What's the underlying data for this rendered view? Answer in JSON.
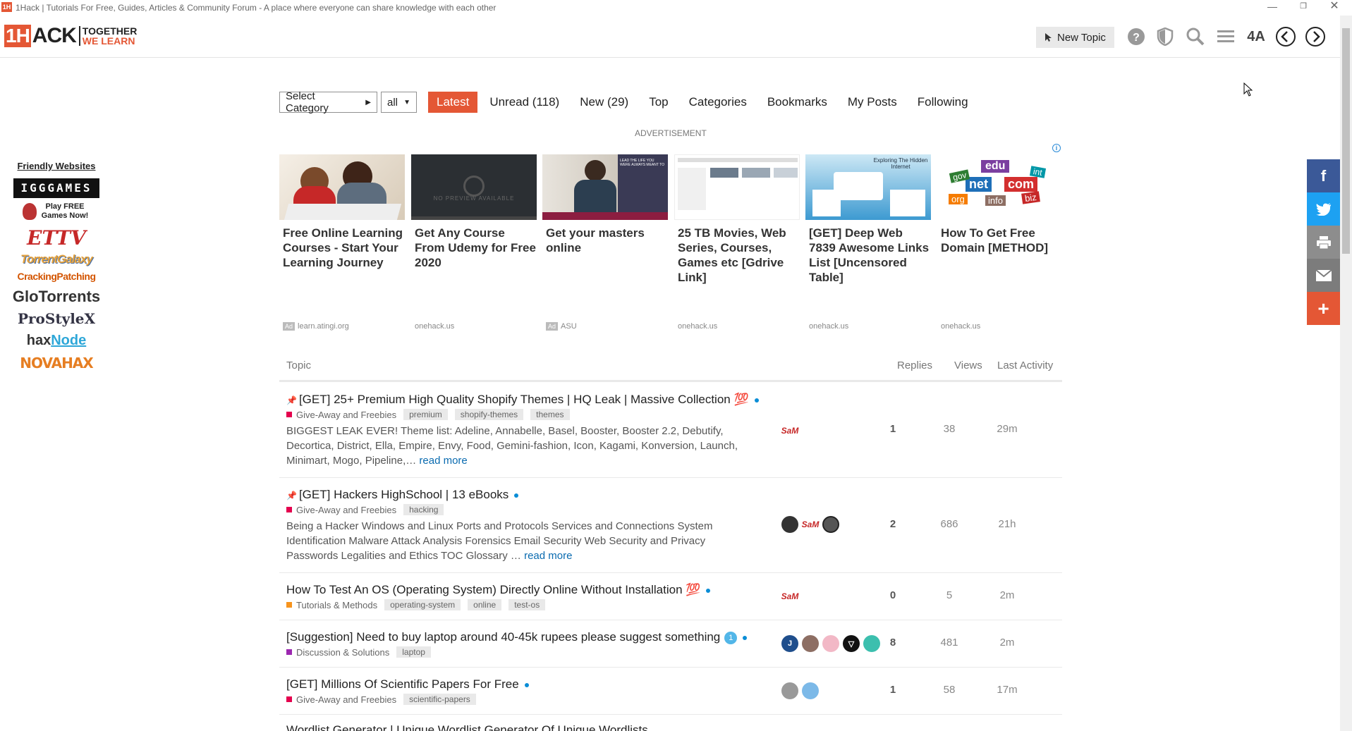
{
  "window": {
    "title": "1Hack | Tutorials For Free, Guides, Articles & Community Forum - A place where everyone can share knowledge with each other",
    "logo_glyph": "1H"
  },
  "header": {
    "logo_main_a": "1H",
    "logo_main_b": "ACK",
    "logo_tag_1": "TOGETHER",
    "logo_tag_2": "WE LEARN",
    "new_topic_label": "New Topic",
    "font_toggle_label": "4A",
    "icons": [
      "help-icon",
      "shield-icon",
      "search-icon",
      "hamburger-menu-icon",
      "font-size-icon",
      "back-arrow-icon",
      "forward-arrow-icon"
    ]
  },
  "sidebar": {
    "heading": "Friendly Websites",
    "sites": [
      "IGGGAMES",
      "Play FREE Games Now!",
      "ETTV",
      "TorrentGalaxy",
      "CrackingPatching",
      "GloTorrents",
      "ProStyleX",
      "hax",
      "Node",
      "NOVAHAX"
    ]
  },
  "share": {
    "icons": [
      "facebook-icon",
      "twitter-icon",
      "print-icon",
      "email-icon",
      "plus-icon"
    ],
    "colors": [
      "#3b5998",
      "#1da1f2",
      "#8d8d8d",
      "#7c7c7c",
      "#e45735"
    ]
  },
  "nav": {
    "category_select": "Select Category",
    "filter_select": "all",
    "items": [
      "Latest",
      "Unread (118)",
      "New (29)",
      "Top",
      "Categories",
      "Bookmarks",
      "My Posts",
      "Following"
    ]
  },
  "ads": {
    "label": "ADVERTISEMENT",
    "cards": [
      {
        "title": "Free Online Learning Courses - Start Your Learning Journey",
        "source": "learn.atingi.org",
        "ad": true
      },
      {
        "title": "Get Any Course From Udemy for Free 2020",
        "source": "onehack.us",
        "ad": false
      },
      {
        "title": "Get your masters online",
        "source": "ASU",
        "ad": true
      },
      {
        "title": "25 TB Movies, Web Series, Courses, Games etc [Gdrive Link]",
        "source": "onehack.us",
        "ad": false
      },
      {
        "title": "[GET] Deep Web 7839 Awesome Links List [Uncensored Table]",
        "source": "onehack.us",
        "ad": false
      },
      {
        "title": "How To Get Free Domain [METHOD]",
        "source": "onehack.us",
        "ad": false
      }
    ],
    "img_udemy_text": "NO PREVIEW AVAILABLE",
    "img_deepweb_text": "Exploring The Hidden Internet",
    "img_masters_text": "LEAD THE LIFE YOU WERE ALWAYS MEANT TO",
    "img_domain_words": [
      "edu",
      "net",
      "com",
      "gov",
      "int",
      "org",
      "info",
      "biz"
    ],
    "ad_badge": "Ad"
  },
  "table": {
    "headers": {
      "topic": "Topic",
      "replies": "Replies",
      "views": "Views",
      "activity": "Last Activity"
    },
    "rows": [
      {
        "title": "[GET] 25+ Premium High Quality Shopify Themes | HQ Leak | Massive Collection 💯",
        "category": "Give-Away and Freebies",
        "tags": [
          "premium",
          "shopify-themes",
          "themes"
        ],
        "excerpt": "BIGGEST LEAK EVER! Theme list: Adeline, Annabelle, Basel, Booster, Booster 2.2, Debutify, Decortica, District, Ella, Empire, Envy, Food, Gemini-fashion, Icon, Kagami, Konversion, Launch, Minimart, Mogo, Pipeline,…",
        "read_more": "read more",
        "replies": "1",
        "views": "38",
        "activity": "29m"
      },
      {
        "title": "[GET] Hackers HighSchool | 13 eBooks",
        "category": "Give-Away and Freebies",
        "tags": [
          "hacking"
        ],
        "excerpt": "Being a Hacker Windows and Linux Ports and Protocols Services and Connections System Identification Malware Attack Analysis Forensics Email Security Web Security and Privacy Passwords Legalities and Ethics TOC Glossary …",
        "read_more": "read more",
        "replies": "2",
        "views": "686",
        "activity": "21h"
      },
      {
        "title": "How To Test An OS (Operating System) Directly Online Without Installation 💯",
        "category": "Tutorials & Methods",
        "tags": [
          "operating-system",
          "online",
          "test-os"
        ],
        "replies": "0",
        "views": "5",
        "activity": "2m"
      },
      {
        "title": "[Suggestion] Need to buy laptop around 40-45k rupees please suggest something",
        "badge": "1",
        "category": "Discussion & Solutions",
        "tags": [
          "laptop"
        ],
        "replies": "8",
        "views": "481",
        "activity": "2m"
      },
      {
        "title": "[GET] Millions Of Scientific Papers For Free",
        "category": "Give-Away and Freebies",
        "tags": [
          "scientific-papers"
        ],
        "replies": "1",
        "views": "58",
        "activity": "17m"
      },
      {
        "title": "Wordlist Generator | Unique Wordlist Generator Of Unique Wordlists"
      }
    ],
    "avatar_labels": {
      "sam": "SaM",
      "j": "J",
      "v": "▽"
    },
    "category_colors": {
      "giveaway": "#e4004e",
      "tutorials": "#f7941d",
      "discussion": "#9c27b0"
    }
  }
}
